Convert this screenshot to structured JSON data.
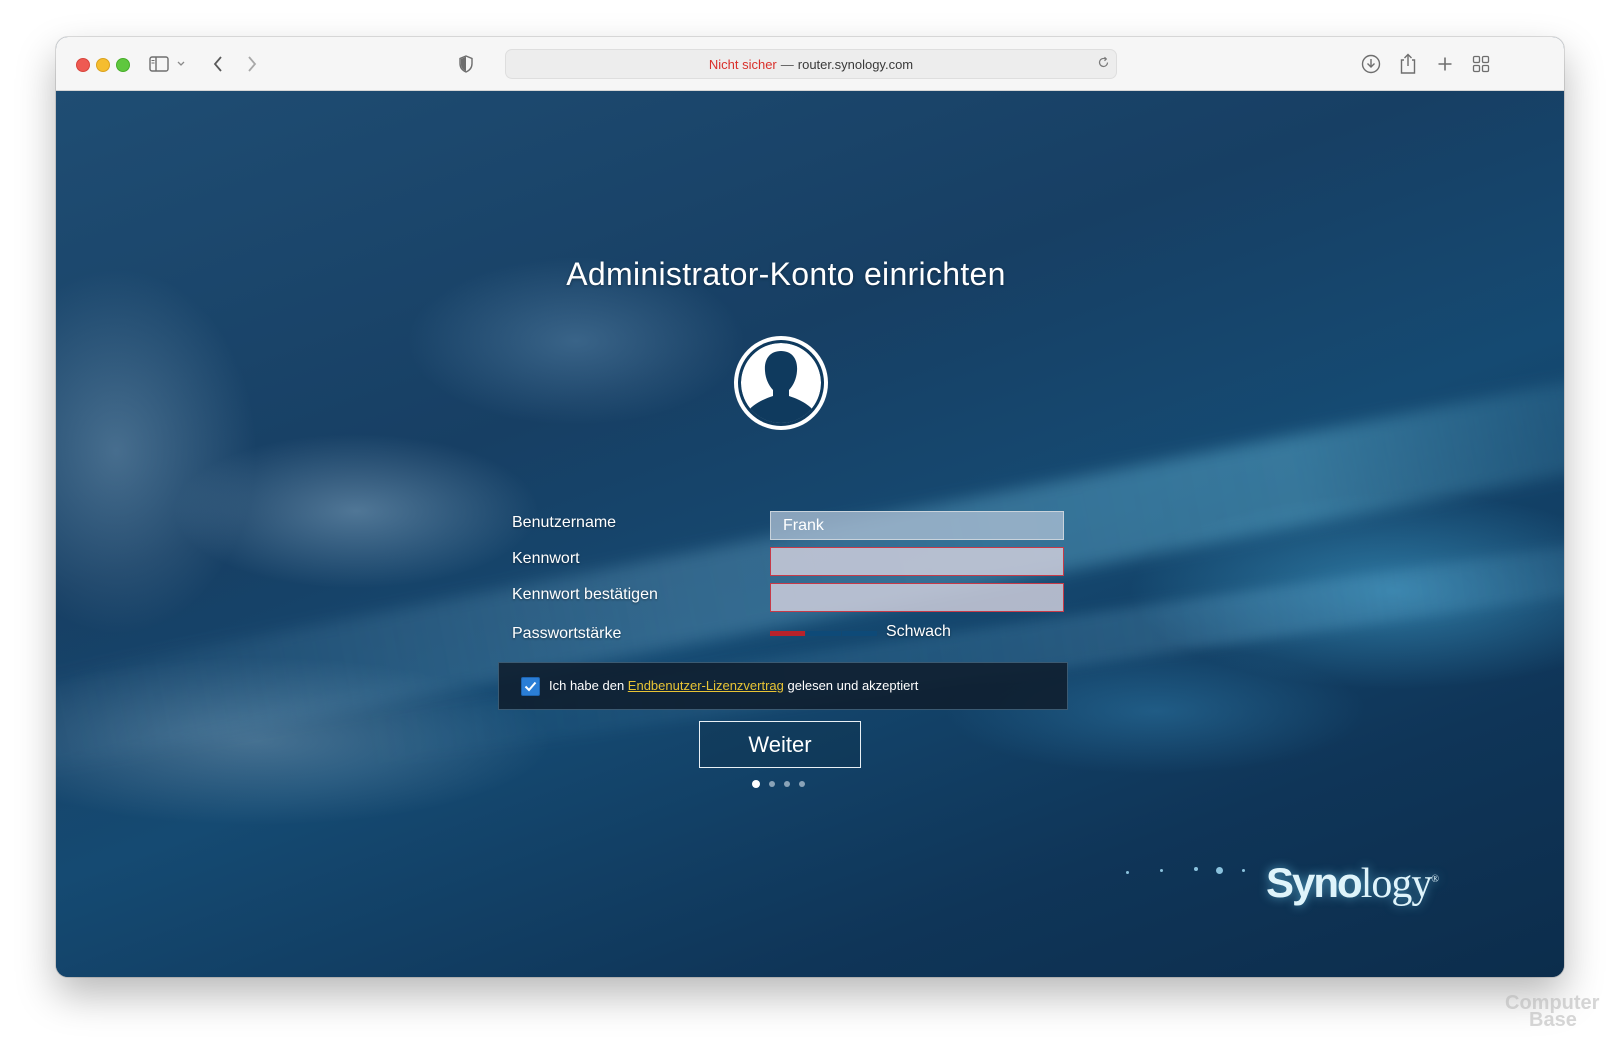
{
  "browser": {
    "url_warning": "Nicht sicher",
    "url_separator": "—",
    "url_host": "router.synology.com"
  },
  "page": {
    "title": "Administrator-Konto einrichten",
    "form": {
      "username_label": "Benutzername",
      "username_value": "Frank",
      "password_label": "Kennwort",
      "password_confirm_label": "Kennwort bestätigen",
      "strength_label": "Passwortstärke",
      "strength_value": "Schwach",
      "strength_level": "1/3"
    },
    "license": {
      "prefix": "Ich habe den ",
      "link": "Endbenutzer-Lizenzvertrag",
      "suffix": " gelesen und akzeptiert",
      "checked": true
    },
    "next_button": "Weiter",
    "steps": {
      "current": 1,
      "total": 4
    },
    "logo_text_bold": "Syno",
    "logo_text": "logy",
    "logo_mark": "®"
  },
  "watermark": {
    "line1": "Computer",
    "line2": "Base"
  },
  "colors": {
    "strength_active": "#b8222b",
    "strength_inactive": "#0e4a78",
    "link": "#e8c435",
    "checkbox": "#2b7ed6"
  }
}
